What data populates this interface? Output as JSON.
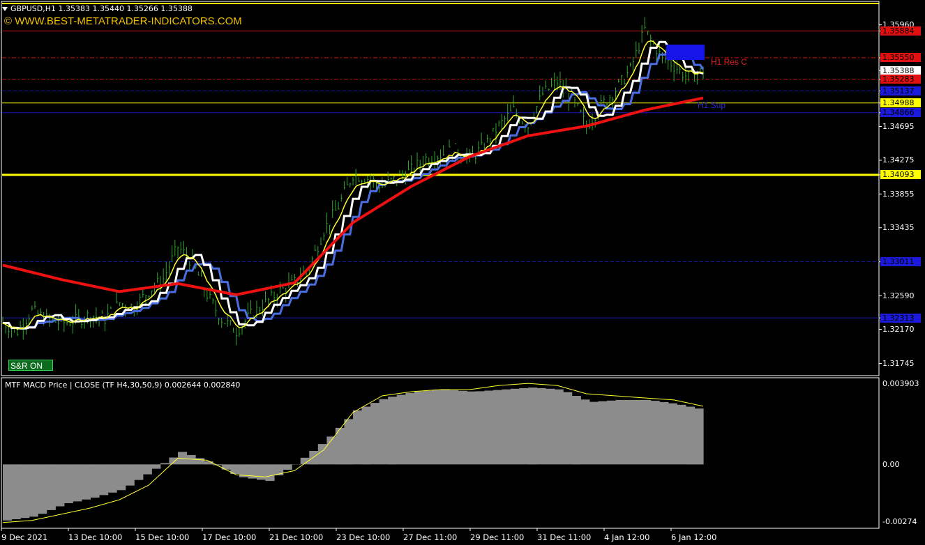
{
  "header": {
    "symbol_info": "GBPUSD,H1  1.35383 1.35440 1.35266 1.35388"
  },
  "watermark": "© WWW.BEST-METATRADER-INDICATORS.COM",
  "snr_button": "S&R  ON",
  "levels": {
    "res_label": "H1 Res C",
    "sup_label": "H1 Sup"
  },
  "price_axis": [
    {
      "text": "1.35960",
      "style": "plain"
    },
    {
      "text": "1.35884",
      "style": "red"
    },
    {
      "text": "1.35550",
      "style": "red"
    },
    {
      "text": "1.35388",
      "style": "white"
    },
    {
      "text": "1.35283",
      "style": "red"
    },
    {
      "text": "1.35137",
      "style": "blue"
    },
    {
      "text": "1.34988",
      "style": "yellow"
    },
    {
      "text": "1.34866",
      "style": "blue"
    },
    {
      "text": "1.34695",
      "style": "plain"
    },
    {
      "text": "1.34275",
      "style": "plain"
    },
    {
      "text": "1.34093",
      "style": "yellow"
    },
    {
      "text": "1.33855",
      "style": "plain"
    },
    {
      "text": "1.33435",
      "style": "plain"
    },
    {
      "text": "1.33011",
      "style": "blue"
    },
    {
      "text": "1.32590",
      "style": "plain"
    },
    {
      "text": "1.32313",
      "style": "blue"
    },
    {
      "text": "1.32170",
      "style": "plain"
    },
    {
      "text": "1.31745",
      "style": "plain"
    }
  ],
  "macd": {
    "title": "MTF MACD Price | CLOSE  (TF H4,30,50,9) 0.002644 0.002840",
    "axis": [
      "0.003903",
      "0.00",
      "-0.00274"
    ]
  },
  "time_axis": [
    "9 Dec 2021",
    "13 Dec 10:00",
    "15 Dec 10:00",
    "17 Dec 10:00",
    "21 Dec 10:00",
    "23 Dec 10:00",
    "27 Dec 11:00",
    "29 Dec 11:00",
    "31 Dec 11:00",
    "4 Jan 12:00",
    "6 Jan 12:00"
  ],
  "colors": {
    "bars": "#2fa82f",
    "ma_fast": "#ffff33",
    "ma_white": "#ffffff",
    "ma_blue": "#4a6ee0",
    "ma_red": "#ee1111",
    "level_yellow": "#ffff00",
    "histogram": "#8c8c8c",
    "signal": "#ffff33"
  },
  "chart_data": [
    {
      "type": "line",
      "title": "GBPUSD,H1",
      "ylim": [
        1.3162,
        1.362
      ],
      "series": [
        {
          "name": "close",
          "x": [
            0,
            5,
            10,
            15,
            20,
            25,
            30,
            35,
            40,
            45,
            50,
            55,
            60,
            65,
            70,
            75,
            80,
            85,
            90,
            95,
            100,
            105,
            110,
            115,
            120,
            125,
            130,
            135,
            140,
            145,
            150,
            155,
            160,
            165,
            170,
            175,
            180,
            185,
            190,
            195,
            200,
            205,
            210,
            215,
            220,
            225,
            230,
            235,
            240
          ],
          "values": [
            1.3225,
            1.3215,
            1.324,
            1.323,
            1.3225,
            1.3228,
            1.3235,
            1.323,
            1.325,
            1.3245,
            1.3265,
            1.328,
            1.332,
            1.33,
            1.326,
            1.323,
            1.3215,
            1.3235,
            1.325,
            1.3265,
            1.3275,
            1.3295,
            1.334,
            1.337,
            1.341,
            1.3405,
            1.3395,
            1.3405,
            1.3415,
            1.343,
            1.3435,
            1.344,
            1.343,
            1.3445,
            1.347,
            1.349,
            1.347,
            1.351,
            1.3525,
            1.3505,
            1.347,
            1.3495,
            1.3515,
            1.354,
            1.359,
            1.356,
            1.3545,
            1.353,
            1.3539
          ]
        },
        {
          "name": "red",
          "x": [
            0,
            20,
            40,
            60,
            80,
            100,
            120,
            140,
            160,
            180,
            200,
            220,
            240
          ],
          "values": [
            1.3297,
            1.3279,
            1.3264,
            1.3274,
            1.326,
            1.3275,
            1.335,
            1.3395,
            1.3432,
            1.3458,
            1.347,
            1.349,
            1.3505
          ]
        }
      ],
      "level_lines": [
        1.35884,
        1.3555,
        1.35283,
        1.35137,
        1.34988,
        1.34866,
        1.34093,
        1.33011,
        1.32313
      ],
      "level_colors": [
        "#d01010",
        "#d01010",
        "#d01010",
        "#1a1ab8",
        "#ffff00",
        "#1a1ab8",
        "#ffff00",
        "#1a1ab8",
        "#1a1ab8"
      ],
      "resistance_zone": {
        "low": 1.3558,
        "high": 1.3572
      }
    },
    {
      "type": "bar",
      "title": "MTF MACD Price | CLOSE  (TF H4,30,50,9) 0.002644 0.002840",
      "ylim": [
        -0.00274,
        0.003903
      ],
      "x": [
        0,
        10,
        20,
        30,
        40,
        50,
        60,
        70,
        80,
        90,
        100,
        110,
        120,
        130,
        140,
        150,
        160,
        170,
        180,
        190,
        200,
        210,
        220,
        230,
        240
      ],
      "values": [
        -0.0027,
        -0.0025,
        -0.0019,
        -0.0016,
        -0.0012,
        -0.0003,
        0.0006,
        0.0001,
        -0.0006,
        -0.0008,
        0.0001,
        0.0012,
        0.0026,
        0.0032,
        0.0035,
        0.0036,
        0.0035,
        0.0036,
        0.0037,
        0.0036,
        0.003,
        0.0031,
        0.0031,
        0.0029,
        0.0026
      ],
      "signal": [
        -0.0028,
        -0.0027,
        -0.0024,
        -0.0021,
        -0.0017,
        -0.001,
        0.0003,
        0.0002,
        -0.0005,
        -0.0006,
        -0.0003,
        0.0007,
        0.0025,
        0.0033,
        0.0035,
        0.0036,
        0.0036,
        0.0038,
        0.0039,
        0.0038,
        0.0034,
        0.0033,
        0.0032,
        0.0031,
        0.0028
      ]
    }
  ]
}
